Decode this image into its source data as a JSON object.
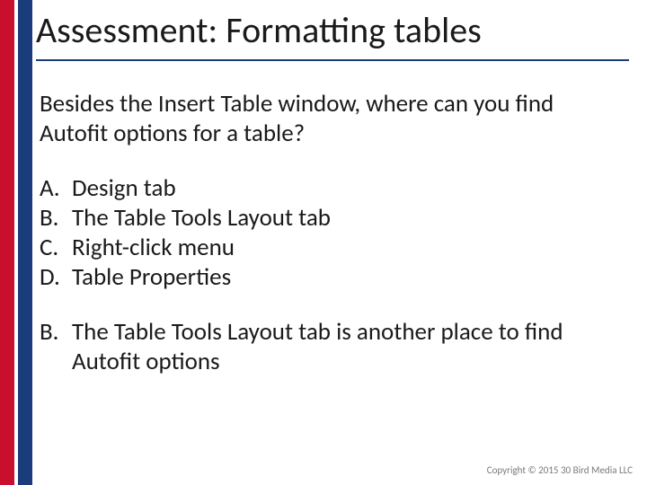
{
  "title": "Assessment: Formatting tables",
  "question": "Besides the Insert Table window, where can you find Autofit options for a table?",
  "choices": [
    {
      "letter": "A.",
      "text": "Design tab"
    },
    {
      "letter": "B.",
      "text": "The Table Tools Layout tab"
    },
    {
      "letter": "C.",
      "text": "Right-click menu"
    },
    {
      "letter": "D.",
      "text": "Table Properties"
    }
  ],
  "answer": {
    "letter": "B.",
    "text": "The Table Tools Layout tab is another place to find Autofit options"
  },
  "footer": "Copyright © 2015 30 Bird Media LLC",
  "colors": {
    "red": "#c8102e",
    "blue": "#1a3c7a"
  }
}
